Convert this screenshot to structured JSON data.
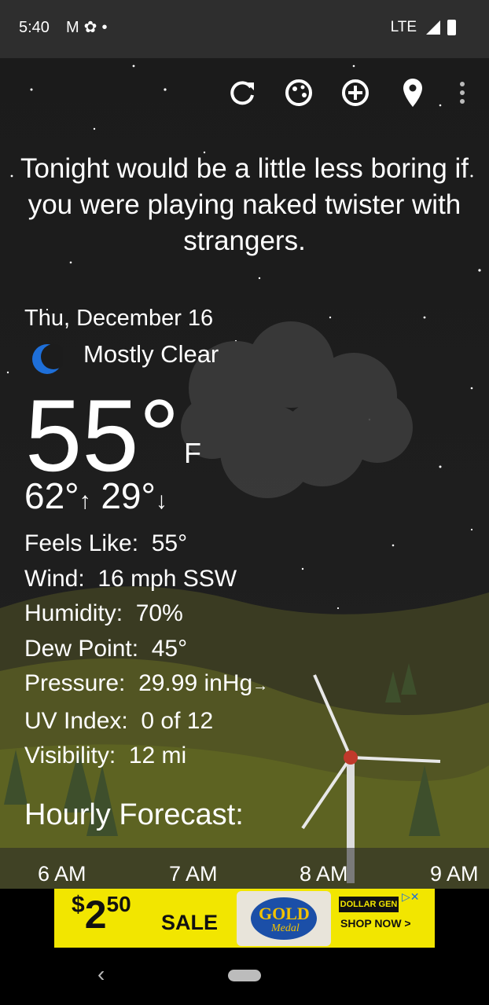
{
  "status_bar": {
    "time": "5:40",
    "left_icons": [
      "gmail-icon",
      "fan-icon",
      "dot-icon"
    ],
    "network": "LTE",
    "right_icons": [
      "signal-icon",
      "battery-icon"
    ]
  },
  "toolbar": {
    "buttons": [
      "refresh-icon",
      "theme-icon",
      "add-location-icon",
      "location-pin-icon",
      "more-vert-icon"
    ]
  },
  "quote": "Tonight would be a little less boring if you were playing naked twister with strangers.",
  "current": {
    "date": "Thu, December 16",
    "condition": "Mostly Clear",
    "temperature": "55°",
    "unit": "F",
    "high": "62°",
    "high_arrow": "↑",
    "low": "29°",
    "low_arrow": "↓"
  },
  "details": {
    "feels_like_label": "Feels Like:",
    "feels_like": "55°",
    "wind_label": "Wind:",
    "wind": "16 mph SSW",
    "humidity_label": "Humidity:",
    "humidity": "70%",
    "dew_point_label": "Dew Point:",
    "dew_point": "45°",
    "pressure_label": "Pressure:",
    "pressure": "29.99 inHg",
    "pressure_trend": "→",
    "uv_label": "UV Index:",
    "uv": "0 of 12",
    "visibility_label": "Visibility:",
    "visibility": "12 mi"
  },
  "hourly": {
    "title": "Hourly Forecast:",
    "hours": [
      "6 AM",
      "7 AM",
      "8 AM",
      "9 AM"
    ]
  },
  "ad": {
    "dollar": "$",
    "price_main": "2",
    "price_cents": "50",
    "sale": "SALE",
    "product_brand": "GOLD",
    "product_sub": "Medal",
    "store": "DOLLAR GEN",
    "cta": "SHOP NOW >"
  },
  "colors": {
    "accent_blue": "#1e6fd9",
    "ad_yellow": "#f2e600",
    "status_bar": "#2e2e2e"
  }
}
